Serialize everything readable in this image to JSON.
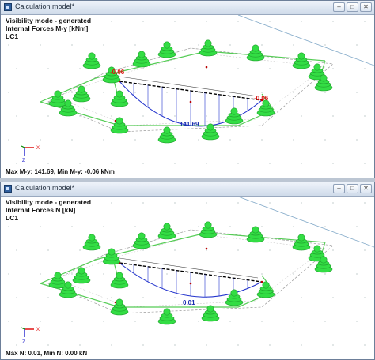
{
  "window1": {
    "title": "Calculation model*",
    "info": [
      "Visibility mode - generated",
      "Internal Forces M-y [kNm]",
      "LC1"
    ],
    "labels": {
      "left": "-0.06",
      "right": "-0.06",
      "mid": "141.69"
    },
    "status": "Max M-y: 141.69, Min M-y: -0.06 kNm"
  },
  "window2": {
    "title": "Calculation model*",
    "info": [
      "Visibility mode - generated",
      "Internal Forces N [kN]",
      "LC1"
    ],
    "labels": {
      "mid": "0.01"
    },
    "status": "Max N: 0.01, Min N: 0.00 kN"
  },
  "axes": {
    "x": "X",
    "z": "Z"
  },
  "colors": {
    "support": "#33dd44",
    "support_dark": "#1f9e2c",
    "diagram": "#2233cc",
    "member": "#55cc55",
    "value_red": "#e01010",
    "value_blue": "#1a2fb0"
  },
  "icons": {
    "minimize": "minimize-icon",
    "maximize": "maximize-icon",
    "close": "close-icon"
  }
}
